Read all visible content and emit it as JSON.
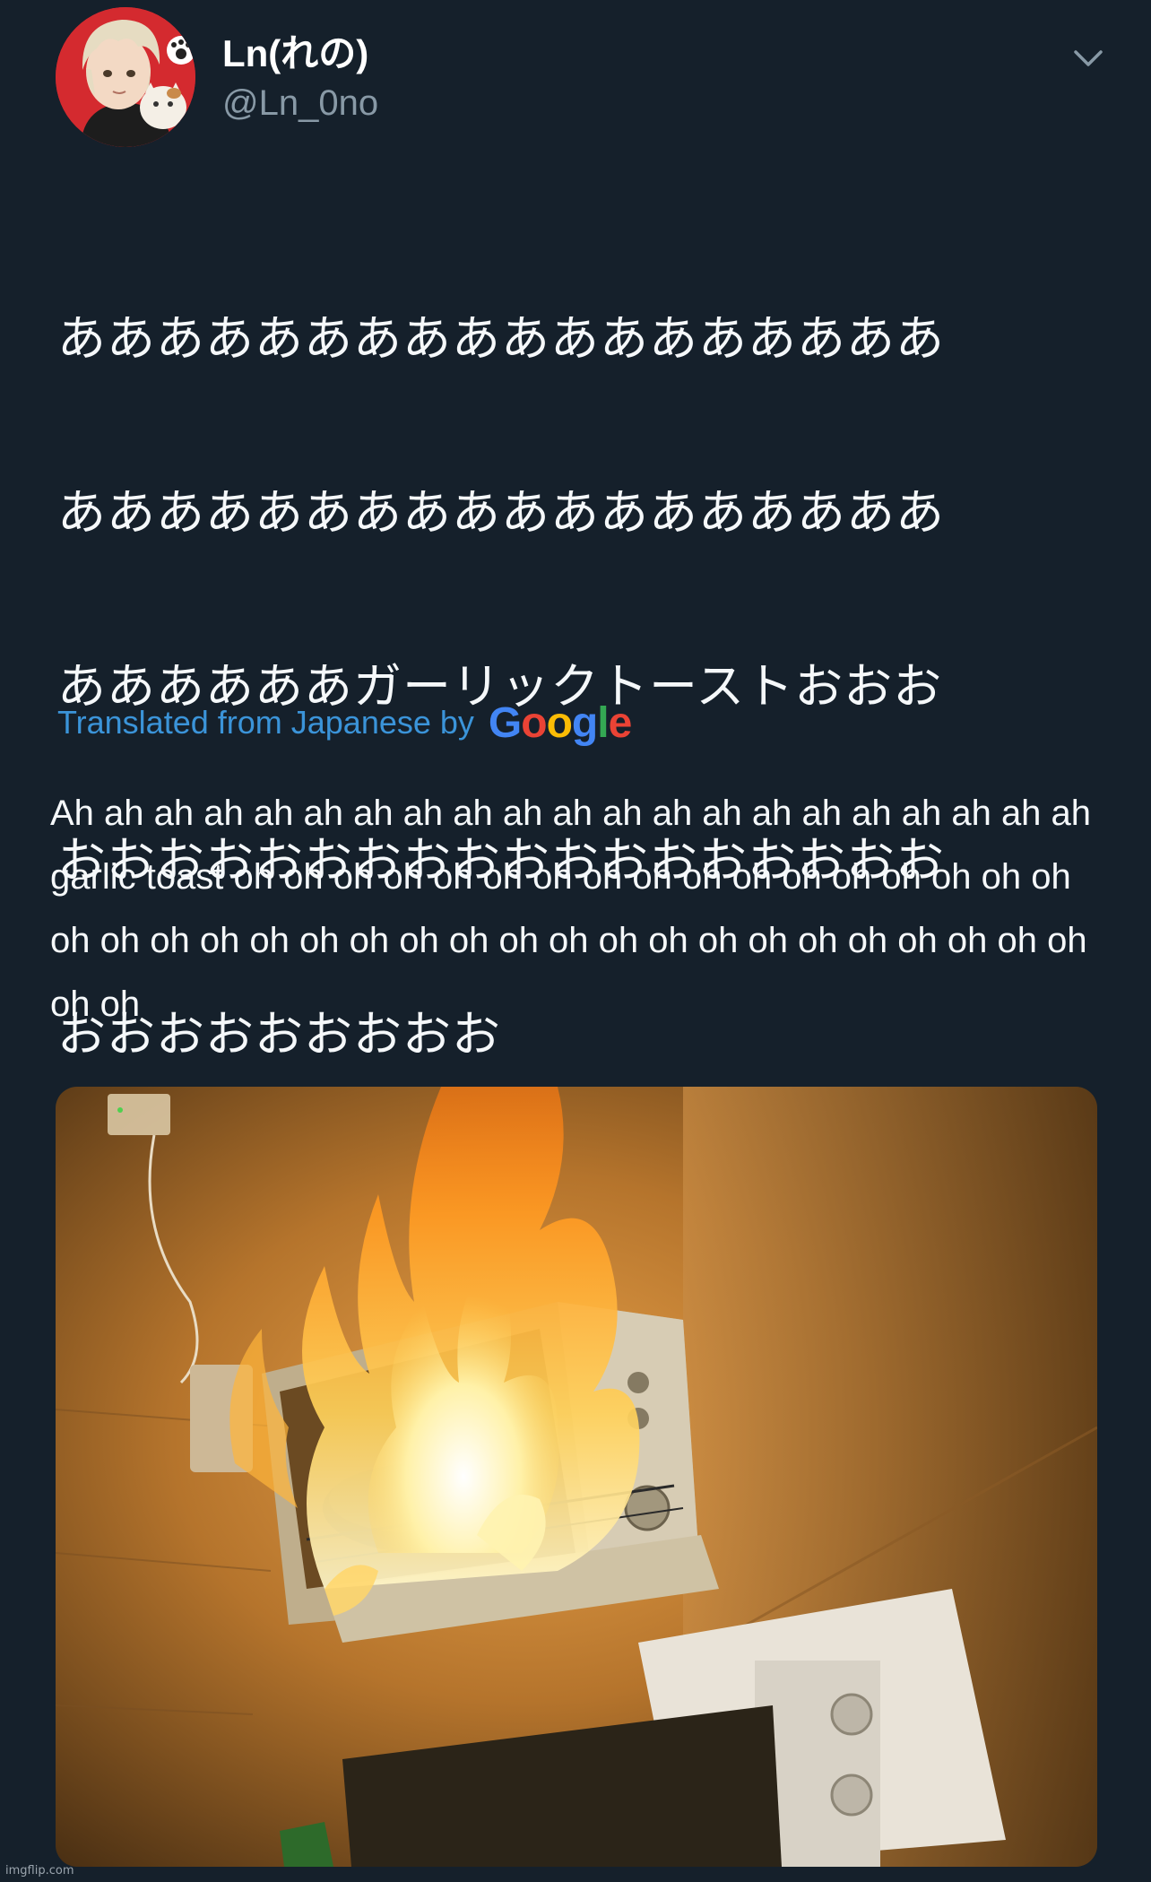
{
  "user": {
    "display_name": "Ln(れの)",
    "handle": "@Ln_0no",
    "avatar_icon": "anime-avatar-icon",
    "avatar_bg": "#d42a2f"
  },
  "tweet": {
    "text_lines": [
      "ああああああああああああああああああ",
      "ああああああああああああああああああ",
      "ああああああガーリックトーストおおお",
      "おおおおおおおおおおおおおおおおおお",
      "おおおおおおおおお"
    ]
  },
  "translation": {
    "label": "Translated from Japanese by",
    "provider_logo": [
      "G",
      "o",
      "o",
      "g",
      "l",
      "e"
    ],
    "provider_colors": [
      "#4285f4",
      "#ea4335",
      "#fbbc05",
      "#4285f4",
      "#34a853",
      "#ea4335"
    ],
    "text": "Ah ah ah ah ah ah ah ah ah ah ah ah ah ah ah ah ah ah ah ah ah garlic toast oh oh oh oh oh oh oh oh oh oh oh oh oh oh oh oh oh oh oh oh oh oh oh oh oh oh oh oh oh oh oh oh oh oh oh oh oh oh oh oh"
  },
  "icons": {
    "more": "chevron-down-icon"
  },
  "colors": {
    "background": "#15202b",
    "link": "#3b94d9",
    "secondary_text": "#8899a6"
  },
  "watermark": "imgflip.com"
}
